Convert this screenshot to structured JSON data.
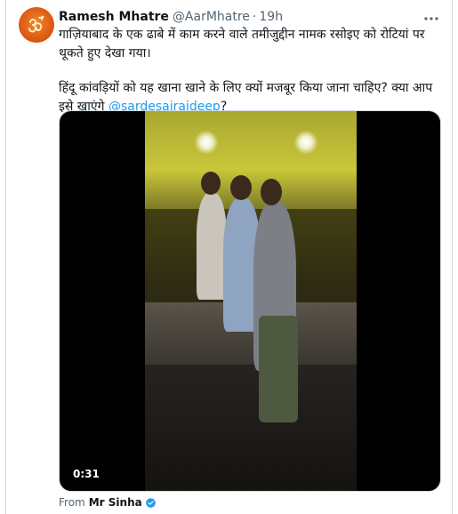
{
  "tweet": {
    "author_name": "Ramesh Mhatre",
    "author_handle": "@AarMhatre",
    "separator": "·",
    "time": "19h",
    "text_line1": "गाज़ियाबाद के एक ढाबे में काम करने वाले तमीजुद्दीन नामक रसोइए को रोटियां पर थूकते हुए देखा गया।",
    "text_line2_pre": "हिंदू कांवड़ियों को यह खाना खाने के लिए क्यों मजबूर किया जाना चाहिए? क्या आप इसे खाएंगे ",
    "mention": "@sardesairajdeep",
    "text_line2_post": "?",
    "video_duration": "0:31",
    "from_label": "From",
    "from_source": "Mr Sinha"
  },
  "icons": {
    "avatar": "om-symbol-icon",
    "more": "more-dots-icon",
    "verified": "verified-badge-icon"
  },
  "colors": {
    "link": "#1d9bf0",
    "secondary_text": "#536471",
    "avatar_orange": "#d9530f"
  }
}
